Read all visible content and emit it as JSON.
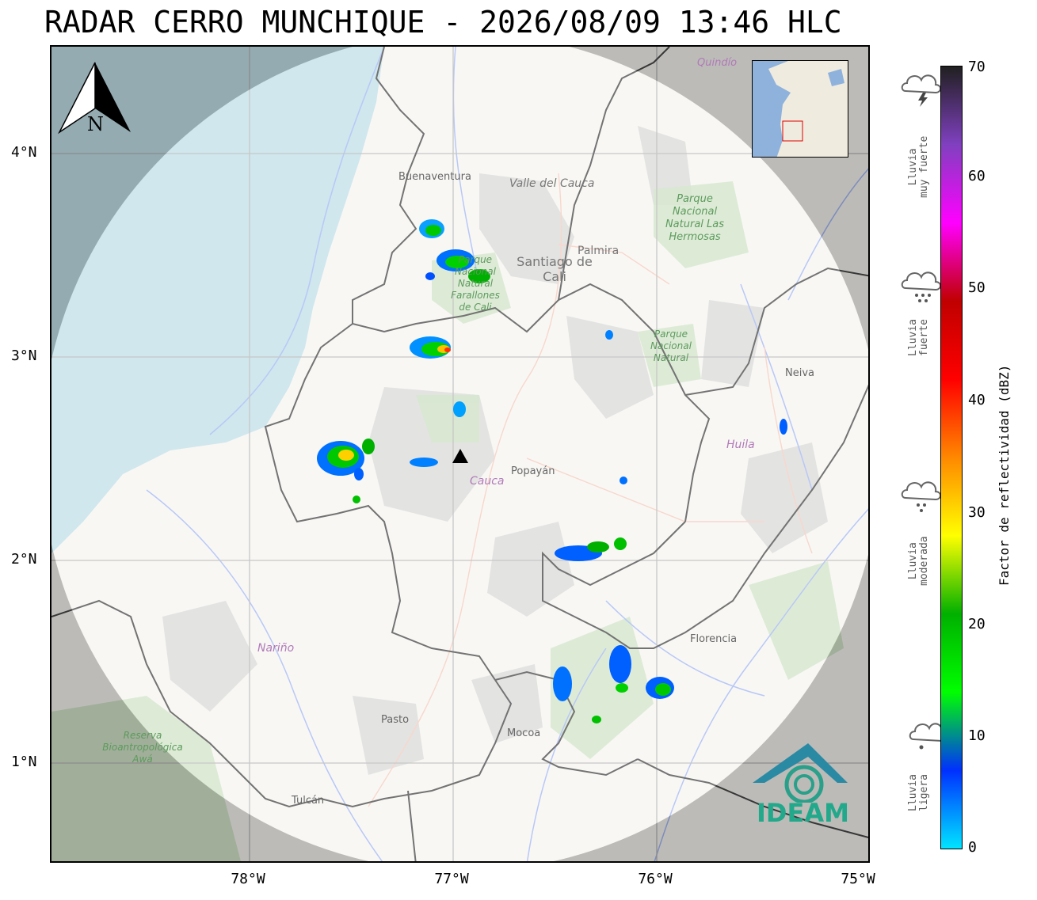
{
  "title": "RADAR CERRO MUNCHIQUE - 2026/08/09 13:46 HLC",
  "axes": {
    "lat_ticks": [
      "4°N",
      "3°N",
      "2°N",
      "1°N"
    ],
    "lon_ticks": [
      "78°W",
      "77°W",
      "76°W",
      "75°W"
    ]
  },
  "north_arrow": "N",
  "places": {
    "buenaventura": "Buenaventura",
    "valle": "Valle del Cauca",
    "palmira": "Palmira",
    "cali": "Santiago de Cali",
    "farallones": "Parque Nacional Natural Farallones de Cali",
    "hermosas": "Parque Nacional Natural Las Hermosas",
    "purace": "Parque Nacional Natural",
    "cauca": "Cauca",
    "popayan": "Popayán",
    "huila": "Huila",
    "neiva": "Neiva",
    "narino": "Nariño",
    "pasto": "Pasto",
    "mocoa": "Mocoa",
    "florencia": "Florencia",
    "tulcan": "Tulcán",
    "awa": "Reserva Bioantropológica Awá",
    "quindio": "Quindío"
  },
  "logo": "IDEAM",
  "colorbar": {
    "label": "Factor de reflectividad (dBZ)",
    "ticks": [
      "0",
      "10",
      "20",
      "30",
      "40",
      "50",
      "60",
      "70"
    ],
    "colors": [
      "#00e5ff",
      "#0030ff",
      "#00ff00",
      "#00b000",
      "#ffff00",
      "#ff8800",
      "#ff0000",
      "#c00000",
      "#ff00ff",
      "#8040c0",
      "#202020"
    ]
  },
  "rain_categories": [
    {
      "label": "Lluvia\nmuy fuerte",
      "icon": "storm-cloud-icon"
    },
    {
      "label": "Lluvia\nfuerte",
      "icon": "heavy-rain-cloud-icon"
    },
    {
      "label": "Lluvia\nmoderada",
      "icon": "moderate-rain-cloud-icon"
    },
    {
      "label": "Lluvia\nligera",
      "icon": "light-rain-cloud-icon"
    }
  ],
  "radar_site_icon": "triangle-marker-icon"
}
